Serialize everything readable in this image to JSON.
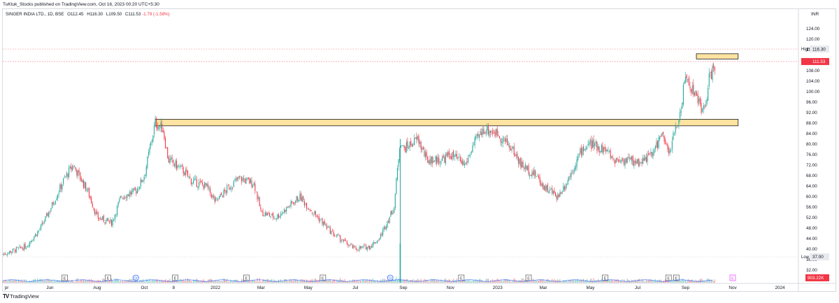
{
  "header": {
    "published": "TuKtuk_Stocks published on TradingView.com, Oct 16, 2023 00:20 UTC+5:30",
    "symbol": "SINGER INDIA LTD., 1D, BSE",
    "open": "O112.45",
    "high": "H116.30",
    "low": "L109.50",
    "close": "C111.53",
    "change": "-1.79 (-1.58%)"
  },
  "footer": {
    "logo": "TV",
    "brand": "TradingView"
  },
  "colors": {
    "up": "#26a69a",
    "down": "#f23645",
    "zone_fill": "#ffe3a1",
    "zone_stroke": "#1a1a1a",
    "volume_ma": "#2962ff"
  },
  "chart_data": {
    "type": "candlestick",
    "currency": "INR",
    "y_ticks": [
      "124.00",
      "120.00",
      "116.00",
      "112.00",
      "108.00",
      "104.00",
      "100.00",
      "96.00",
      "92.00",
      "88.00",
      "84.00",
      "80.00",
      "76.00",
      "72.00",
      "68.00",
      "64.00",
      "60.00",
      "56.00",
      "52.00",
      "48.00",
      "44.00",
      "40.00",
      "36.00",
      "32.00"
    ],
    "ylim": [
      29,
      127
    ],
    "x_ticks": [
      "pr",
      "Jun",
      "Aug",
      "Oct",
      "8",
      "2022",
      "Mar",
      "May",
      "Jul",
      "Sep",
      "Nov",
      "2023",
      "Mar",
      "May",
      "Jul",
      "Sep",
      "Nov",
      "2024"
    ],
    "price_labels": {
      "high_label": "High",
      "high": 116.3,
      "high_text": "116.30",
      "last": 111.53,
      "last_text": "111.53",
      "low_label": "Low",
      "low": 37.0,
      "low_text": "37.00",
      "volume_text": "903.22K"
    },
    "zones": [
      {
        "name": "support-resistance-zone",
        "y_top": 89.5,
        "y_bottom": 87.0,
        "x_start": "2021-10",
        "x_end": "2023-11"
      },
      {
        "name": "recent-high-zone",
        "y_top": 114.5,
        "y_bottom": 112.5,
        "x_start": "2023-09",
        "x_end": "2023-11"
      }
    ],
    "markers": [
      "E",
      "E",
      "D",
      "E",
      "E",
      "E",
      "D",
      "E",
      "E",
      "E",
      "E",
      "E",
      "E"
    ],
    "future_marker": "E",
    "series": [
      {
        "points": [
          [
            "2021-04",
            38
          ],
          [
            "2021-05",
            41
          ],
          [
            "2021-05-20",
            48
          ],
          [
            "2021-06",
            55
          ],
          [
            "2021-06-20",
            67
          ],
          [
            "2021-07",
            72
          ],
          [
            "2021-07-20",
            62
          ],
          [
            "2021-08",
            52
          ],
          [
            "2021-08-20",
            50
          ],
          [
            "2021-09",
            60
          ],
          [
            "2021-09-20",
            62
          ],
          [
            "2021-10",
            68
          ],
          [
            "2021-10-15",
            88
          ],
          [
            "2021-10-25",
            86
          ],
          [
            "2021-11",
            74
          ],
          [
            "2021-11-20",
            70
          ],
          [
            "2021-12",
            66
          ],
          [
            "2021-12-20",
            64
          ],
          [
            "2022-01",
            58
          ],
          [
            "2022-01-20",
            64
          ],
          [
            "2022-02",
            67
          ],
          [
            "2022-02-20",
            65
          ],
          [
            "2022-03",
            54
          ],
          [
            "2022-03-20",
            52
          ],
          [
            "2022-04",
            55
          ],
          [
            "2022-04-20",
            60
          ],
          [
            "2022-05",
            56
          ],
          [
            "2022-05-20",
            50
          ],
          [
            "2022-06",
            46
          ],
          [
            "2022-06-20",
            42
          ],
          [
            "2022-07",
            40
          ],
          [
            "2022-07-20",
            41
          ],
          [
            "2022-08",
            44
          ],
          [
            "2022-08-20",
            56
          ],
          [
            "2022-08-28",
            82
          ],
          [
            "2022-09",
            78
          ],
          [
            "2022-09-20",
            82
          ],
          [
            "2022-10",
            74
          ],
          [
            "2022-10-20",
            74
          ],
          [
            "2022-11",
            76
          ],
          [
            "2022-11-20",
            72
          ],
          [
            "2022-12",
            80
          ],
          [
            "2022-12-15",
            86
          ],
          [
            "2023-01",
            84
          ],
          [
            "2023-01-20",
            78
          ],
          [
            "2023-02",
            72
          ],
          [
            "2023-02-20",
            68
          ],
          [
            "2023-03",
            64
          ],
          [
            "2023-03-20",
            60
          ],
          [
            "2023-04",
            66
          ],
          [
            "2023-04-20",
            78
          ],
          [
            "2023-05",
            80
          ],
          [
            "2023-05-20",
            78
          ],
          [
            "2023-06",
            74
          ],
          [
            "2023-06-20",
            74
          ],
          [
            "2023-07",
            73
          ],
          [
            "2023-07-20",
            76
          ],
          [
            "2023-08",
            84
          ],
          [
            "2023-08-10",
            76
          ],
          [
            "2023-08-25",
            92
          ],
          [
            "2023-09",
            106
          ],
          [
            "2023-09-15",
            98
          ],
          [
            "2023-09-25",
            92
          ],
          [
            "2023-10",
            104
          ],
          [
            "2023-10-10",
            111.53
          ]
        ]
      }
    ]
  }
}
